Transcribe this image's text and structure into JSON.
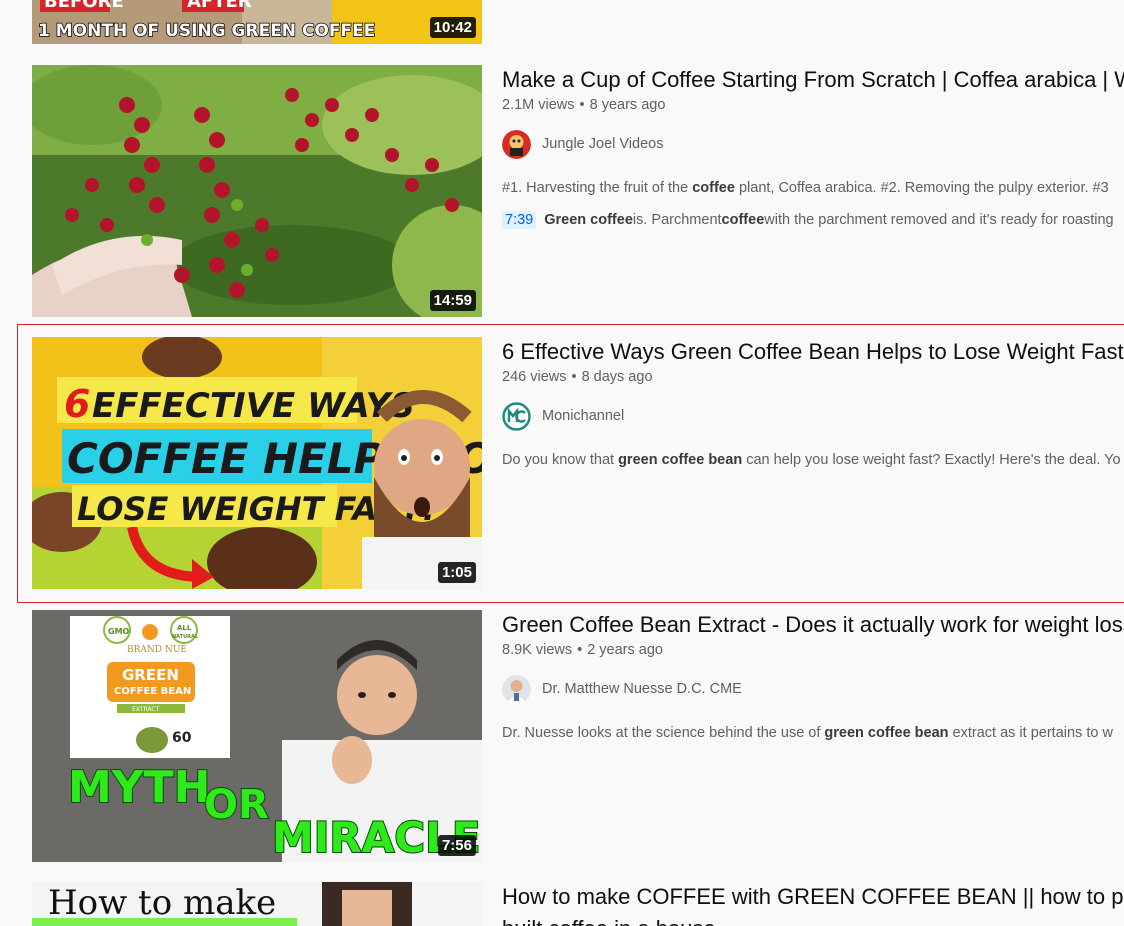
{
  "results": [
    {
      "thumb_caption_line1": "BEFORE",
      "thumb_caption_line1b": "AFTER",
      "thumb_caption_line2": "1 MONTH OF USING GREEN COFFEE",
      "duration": "10:42"
    },
    {
      "title": "Make a Cup of Coffee Starting From Scratch | Coffea arabica | W",
      "views": "2.1M views",
      "age": "8 years ago",
      "channel": "Jungle Joel Videos",
      "desc_parts": [
        "#1. Harvesting the fruit of the ",
        "coffee",
        " plant, Coffea arabica. #2. Removing the pulpy exterior. #3"
      ],
      "chapter_time": "7:39",
      "chapter_parts": [
        "Green coffee",
        " is. Parchment ",
        "coffee",
        " with the parchment removed and it's ready for roasting"
      ],
      "duration": "14:59"
    },
    {
      "title": "6 Effective Ways Green Coffee Bean Helps to Lose Weight Fast",
      "views": "246 views",
      "age": "8 days ago",
      "channel": "Monichannel",
      "desc_parts": [
        "Do you know that ",
        "green coffee bean",
        " can help you lose weight fast? Exactly! Here's the deal. Yo"
      ],
      "thumb_text": [
        "6",
        "EFFECTIVE WAYS",
        "COFFEE HELPS TO",
        "LOSE WEIGHT FAST!"
      ],
      "duration": "1:05"
    },
    {
      "title": "Green Coffee Bean Extract - Does it actually work for weight loss",
      "views": "8.9K views",
      "age": "2 years ago",
      "channel": "Dr. Matthew Nuesse D.C. CME",
      "desc_parts": [
        "Dr. Nuesse looks at the science behind the use of ",
        "green coffee bean",
        " extract as it pertains to w"
      ],
      "thumb_text": [
        "GMO",
        "ALL",
        "NATURAL",
        "BRAND NUE",
        "GREEN",
        "COFFEE BEAN",
        "EXTRACT",
        "60",
        "MYTH",
        "OR",
        "MIRACLE?"
      ],
      "duration": "7:56"
    },
    {
      "title": "How to make COFFEE with GREEN COFFEE BEAN || how to pure",
      "title_line2": "built coffee in a house",
      "thumb_text": "How to make"
    }
  ],
  "colors": {
    "highlight": "#e02020",
    "chapter_bg": "#def1ff",
    "chapter_fg": "#065fd4"
  }
}
